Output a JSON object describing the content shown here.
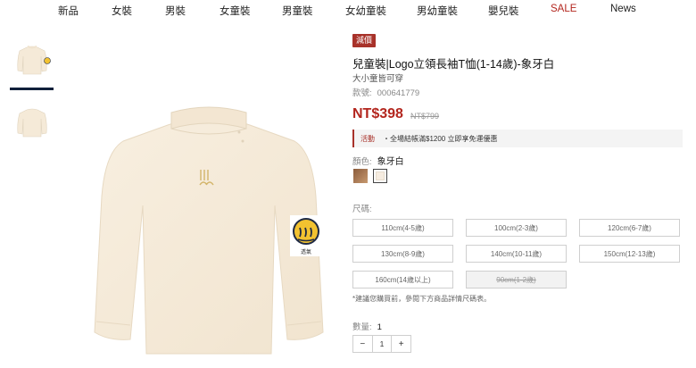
{
  "nav": {
    "items": [
      "新品",
      "女裝",
      "男裝",
      "女童裝",
      "男童裝",
      "女幼童裝",
      "男幼童裝",
      "嬰兒裝",
      "SALE",
      "News"
    ]
  },
  "product": {
    "tag": "減價",
    "title": "兒童裝|Logo立領長袖T恤(1-14歲)-象牙白",
    "subtitle": "大小童皆可穿",
    "sku_label": "款號:",
    "sku_value": "000641779",
    "price": "NT$398",
    "original_price": "NT$799",
    "badge_label": "透氣"
  },
  "promo": {
    "label": "活動",
    "text": "・全場結帳滿$1200 立即享免運優惠"
  },
  "color": {
    "label": "顏色:",
    "selected": "象牙白"
  },
  "size": {
    "label": "尺碼:",
    "options": [
      "110cm(4-5歲)",
      "100cm(2-3歲)",
      "120cm(6-7歲)",
      "130cm(8-9歲)",
      "140cm(10-11歲)",
      "150cm(12-13歲)",
      "160cm(14歲以上)",
      "90cm(1-2歲)"
    ],
    "note": "*建議您購買前，參閱下方商品詳情尺碼表。"
  },
  "quantity": {
    "label": "數量:",
    "value": "1",
    "minus": "−",
    "plus": "+"
  },
  "colors": {
    "accent": "#a8322a",
    "price": "#b3261e",
    "nav_dark": "#0f1f3a"
  }
}
